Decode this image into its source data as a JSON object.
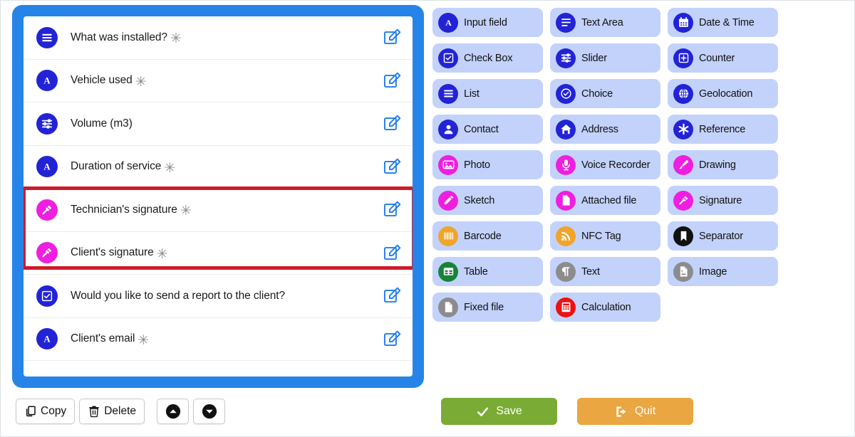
{
  "colors": {
    "panel_blue": "#2684e8",
    "selection_red": "#cf1a2b",
    "palette_button_bg": "#c3d2fb",
    "icon_blue": "#2323d6",
    "icon_magenta": "#ee1fe0",
    "icon_orange": "#f0a429",
    "icon_green": "#188338",
    "icon_gray": "#8c8c8c",
    "icon_black": "#111111",
    "icon_red": "#ee1111",
    "save_green": "#7aab35",
    "quit_orange": "#eaa640",
    "edit_icon_blue": "#1f7ced"
  },
  "form": {
    "required_marker": "✳",
    "fields": [
      {
        "label": "What was installed?",
        "required": true,
        "icon": "list-icon",
        "icon_color": "#2323d6"
      },
      {
        "label": "Vehicle used",
        "required": true,
        "icon": "input-field-icon",
        "icon_color": "#2323d6"
      },
      {
        "label": "Volume (m3)",
        "required": false,
        "icon": "slider-icon",
        "icon_color": "#2323d6"
      },
      {
        "label": "Duration of service",
        "required": true,
        "icon": "input-field-icon",
        "icon_color": "#2323d6"
      },
      {
        "label": "Technician's signature",
        "required": true,
        "icon": "signature-icon",
        "icon_color": "#ee1fe0",
        "selected": true
      },
      {
        "label": "Client's signature",
        "required": true,
        "icon": "signature-icon",
        "icon_color": "#ee1fe0",
        "selected": true
      },
      {
        "label": "Would you like to send a report to the client?",
        "required": false,
        "icon": "check-box-icon",
        "icon_color": "#2323d6"
      },
      {
        "label": "Client's email",
        "required": true,
        "icon": "input-field-icon",
        "icon_color": "#2323d6"
      }
    ]
  },
  "palette": {
    "items": [
      {
        "label": "Input field",
        "icon": "input-field-icon",
        "icon_color": "#2323d6"
      },
      {
        "label": "Text Area",
        "icon": "text-area-icon",
        "icon_color": "#2323d6"
      },
      {
        "label": "Date & Time",
        "icon": "calendar-icon",
        "icon_color": "#2323d6"
      },
      {
        "label": "Check Box",
        "icon": "check-box-icon",
        "icon_color": "#2323d6"
      },
      {
        "label": "Slider",
        "icon": "slider-icon",
        "icon_color": "#2323d6"
      },
      {
        "label": "Counter",
        "icon": "counter-icon",
        "icon_color": "#2323d6"
      },
      {
        "label": "List",
        "icon": "list-icon",
        "icon_color": "#2323d6"
      },
      {
        "label": "Choice",
        "icon": "choice-icon",
        "icon_color": "#2323d6"
      },
      {
        "label": "Geolocation",
        "icon": "globe-icon",
        "icon_color": "#2323d6"
      },
      {
        "label": "Contact",
        "icon": "contact-icon",
        "icon_color": "#2323d6"
      },
      {
        "label": "Address",
        "icon": "home-icon",
        "icon_color": "#2323d6"
      },
      {
        "label": "Reference",
        "icon": "asterisk-icon",
        "icon_color": "#2323d6"
      },
      {
        "label": "Photo",
        "icon": "photo-icon",
        "icon_color": "#ee1fe0"
      },
      {
        "label": "Voice Recorder",
        "icon": "microphone-icon",
        "icon_color": "#ee1fe0"
      },
      {
        "label": "Drawing",
        "icon": "brush-icon",
        "icon_color": "#ee1fe0"
      },
      {
        "label": "Sketch",
        "icon": "pencil-icon",
        "icon_color": "#ee1fe0"
      },
      {
        "label": "Attached file",
        "icon": "file-icon",
        "icon_color": "#ee1fe0"
      },
      {
        "label": "Signature",
        "icon": "signature-icon",
        "icon_color": "#ee1fe0"
      },
      {
        "label": "Barcode",
        "icon": "barcode-icon",
        "icon_color": "#f0a429"
      },
      {
        "label": "NFC Tag",
        "icon": "nfc-icon",
        "icon_color": "#f0a429"
      },
      {
        "label": "Separator",
        "icon": "bookmark-icon",
        "icon_color": "#111111"
      },
      {
        "label": "Table",
        "icon": "table-icon",
        "icon_color": "#188338"
      },
      {
        "label": "Text",
        "icon": "paragraph-icon",
        "icon_color": "#8c8c8c"
      },
      {
        "label": "Image",
        "icon": "image-file-icon",
        "icon_color": "#8c8c8c"
      },
      {
        "label": "Fixed file",
        "icon": "file-icon",
        "icon_color": "#8c8c8c"
      },
      {
        "label": "Calculation",
        "icon": "calculator-icon",
        "icon_color": "#ee1111"
      }
    ]
  },
  "toolbar": {
    "copy_label": "Copy",
    "delete_label": "Delete",
    "move_up_label": "",
    "move_down_label": ""
  },
  "actions": {
    "save_label": "Save",
    "quit_label": "Quit"
  }
}
